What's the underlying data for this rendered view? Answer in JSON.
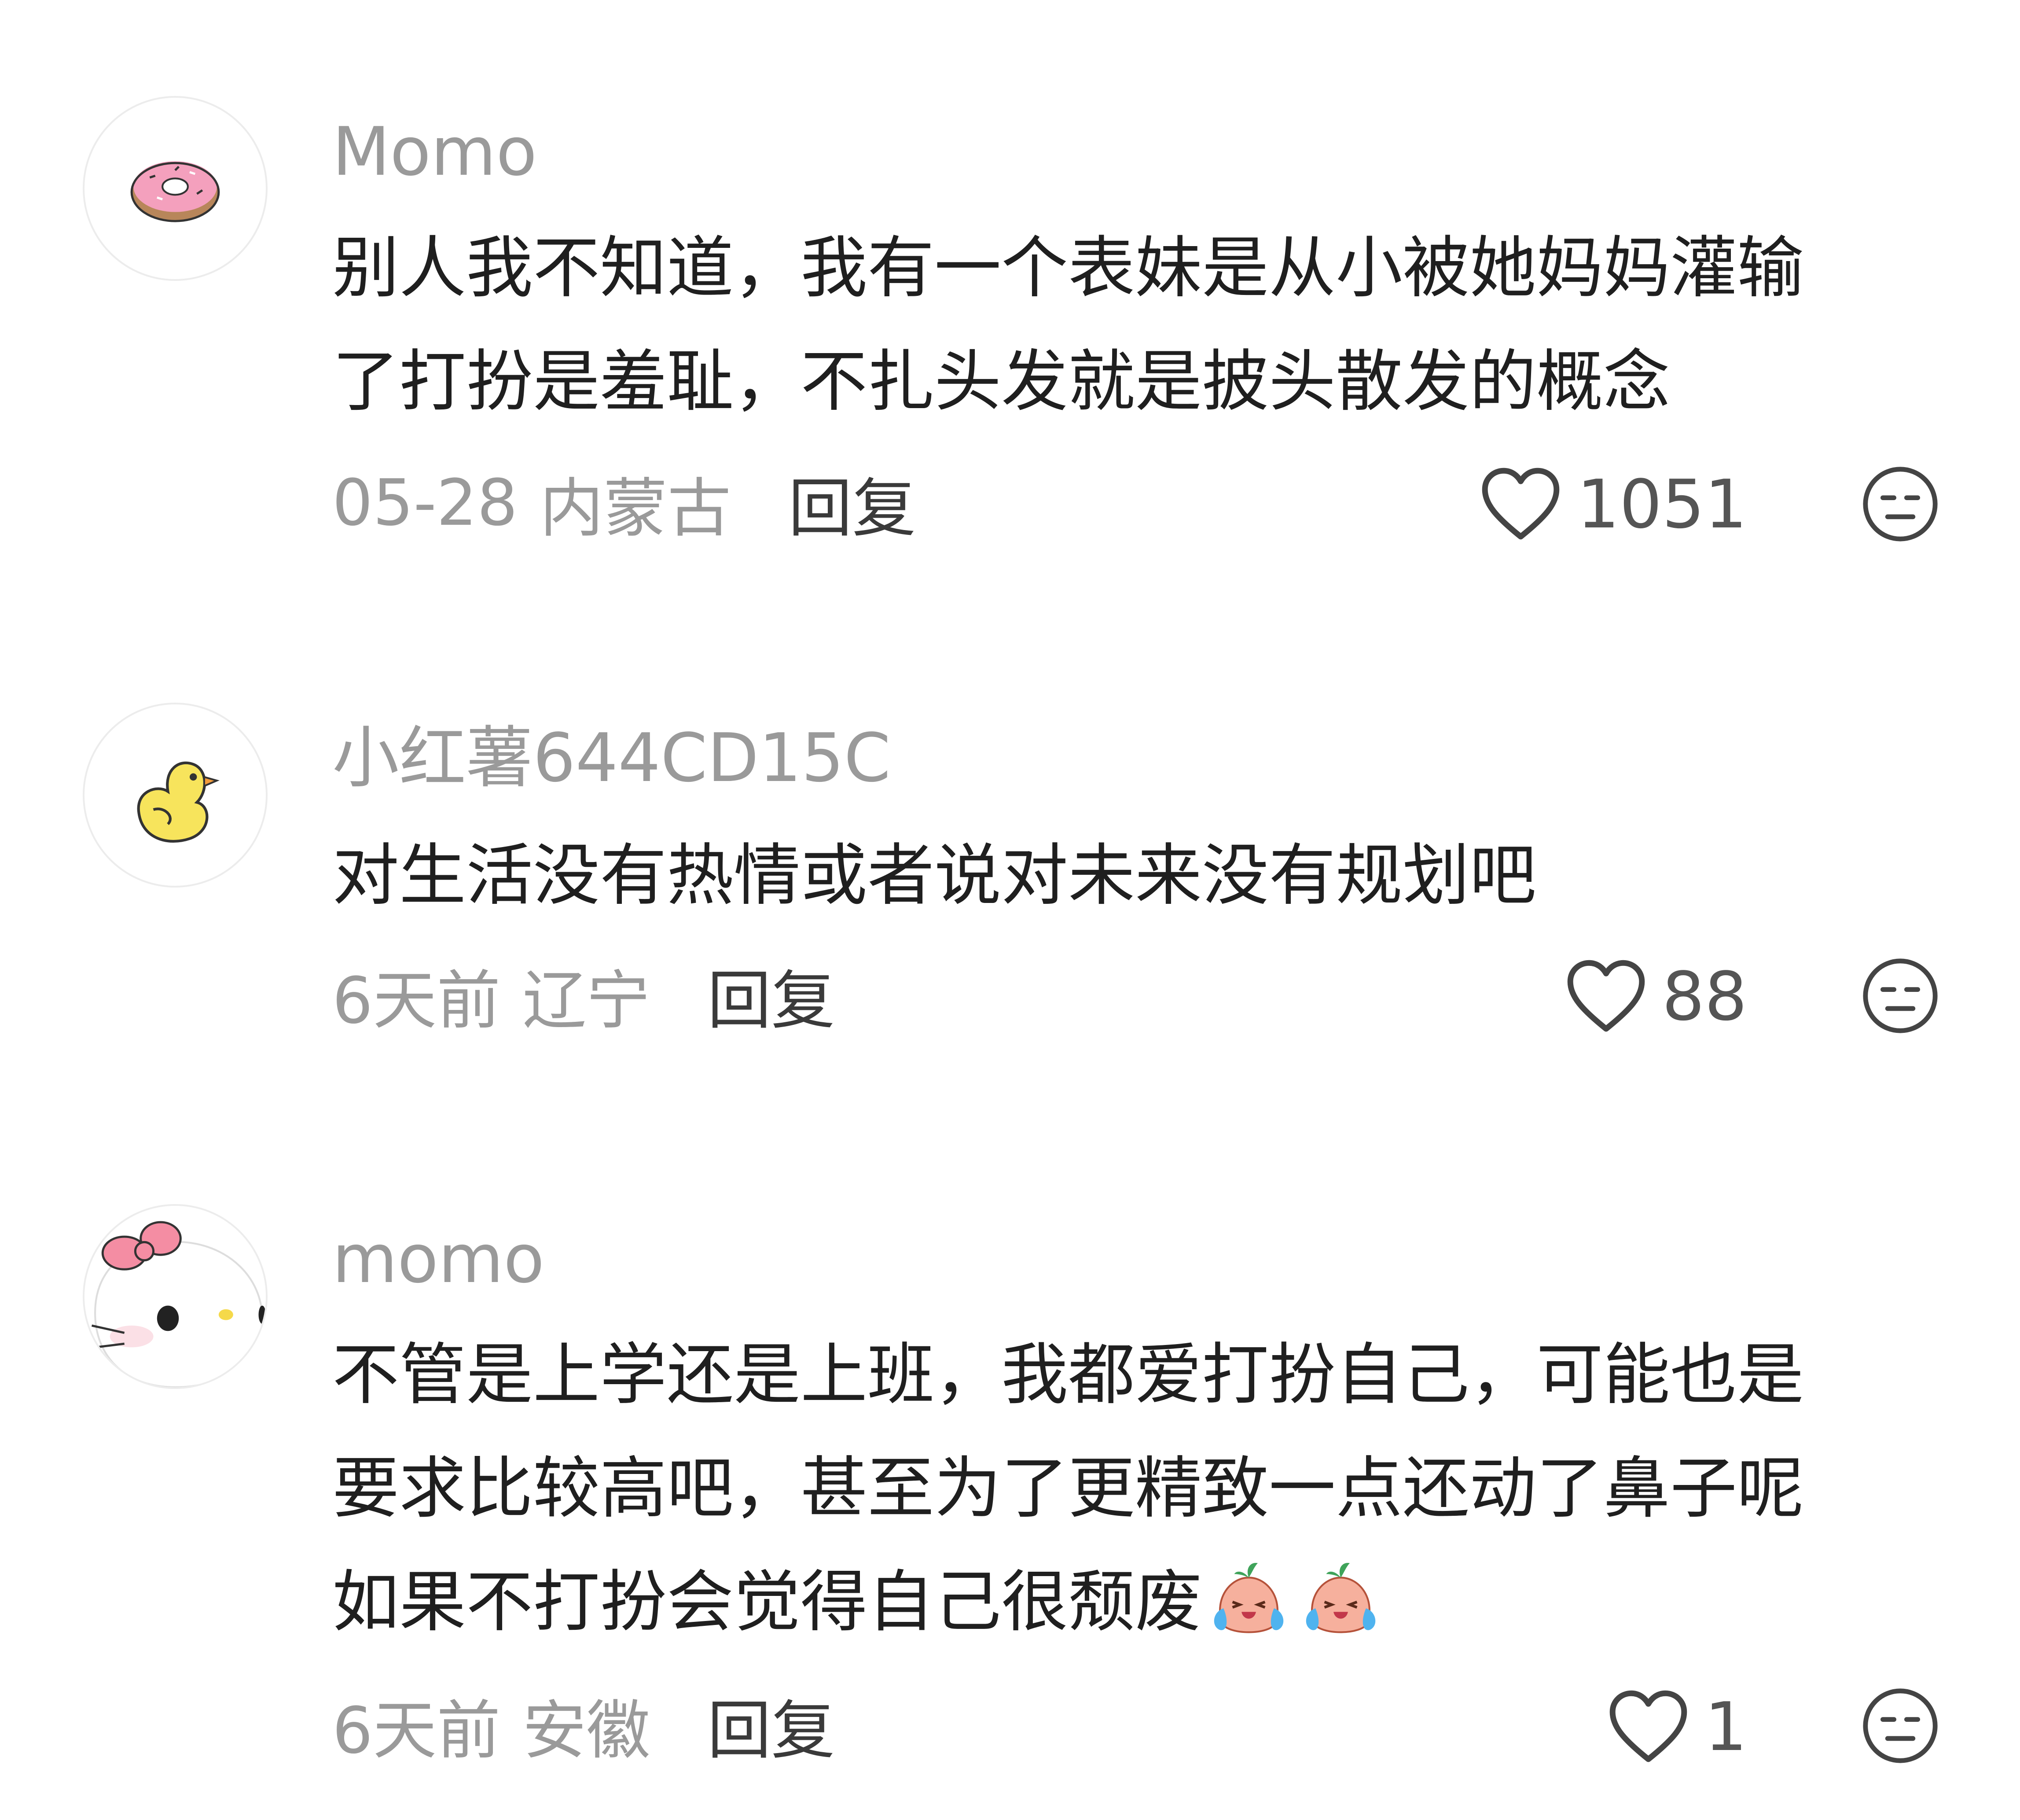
{
  "comments": [
    {
      "username": "Momo",
      "avatar": "donut-avatar",
      "lines": [
        "别人我不知道，我有一个表妹是从小被她妈妈灌输",
        "了打扮是羞耻，不扎头发就是披头散发的概念"
      ],
      "time": "05-28",
      "location": "内蒙古",
      "reply_label": "回复",
      "likes": "1051"
    },
    {
      "username": "小红薯644CD15C",
      "avatar": "duck-avatar",
      "lines": [
        "对生活没有热情或者说对未来没有规划吧"
      ],
      "time": "6天前",
      "location": "辽宁",
      "reply_label": "回复",
      "likes": "88"
    },
    {
      "username": "momo",
      "avatar": "hello-kitty-avatar",
      "lines": [
        "不管是上学还是上班，我都爱打扮自己，可能也是",
        "要求比较高吧，甚至为了更精致一点还动了鼻子呢",
        "如果不打扮会觉得自己很颓废"
      ],
      "emojis": [
        "crying-peach-emoji",
        "crying-peach-emoji"
      ],
      "time": "6天前",
      "location": "安徽",
      "reply_label": "回复",
      "likes": "1"
    }
  ],
  "icons": {
    "like": "heart-outline-icon",
    "dislike": "meh-face-icon"
  },
  "colors": {
    "username": "#9a9a9a",
    "text": "#1f1f1f",
    "meta": "#9a9a9a",
    "reply": "#3a3a3a"
  }
}
